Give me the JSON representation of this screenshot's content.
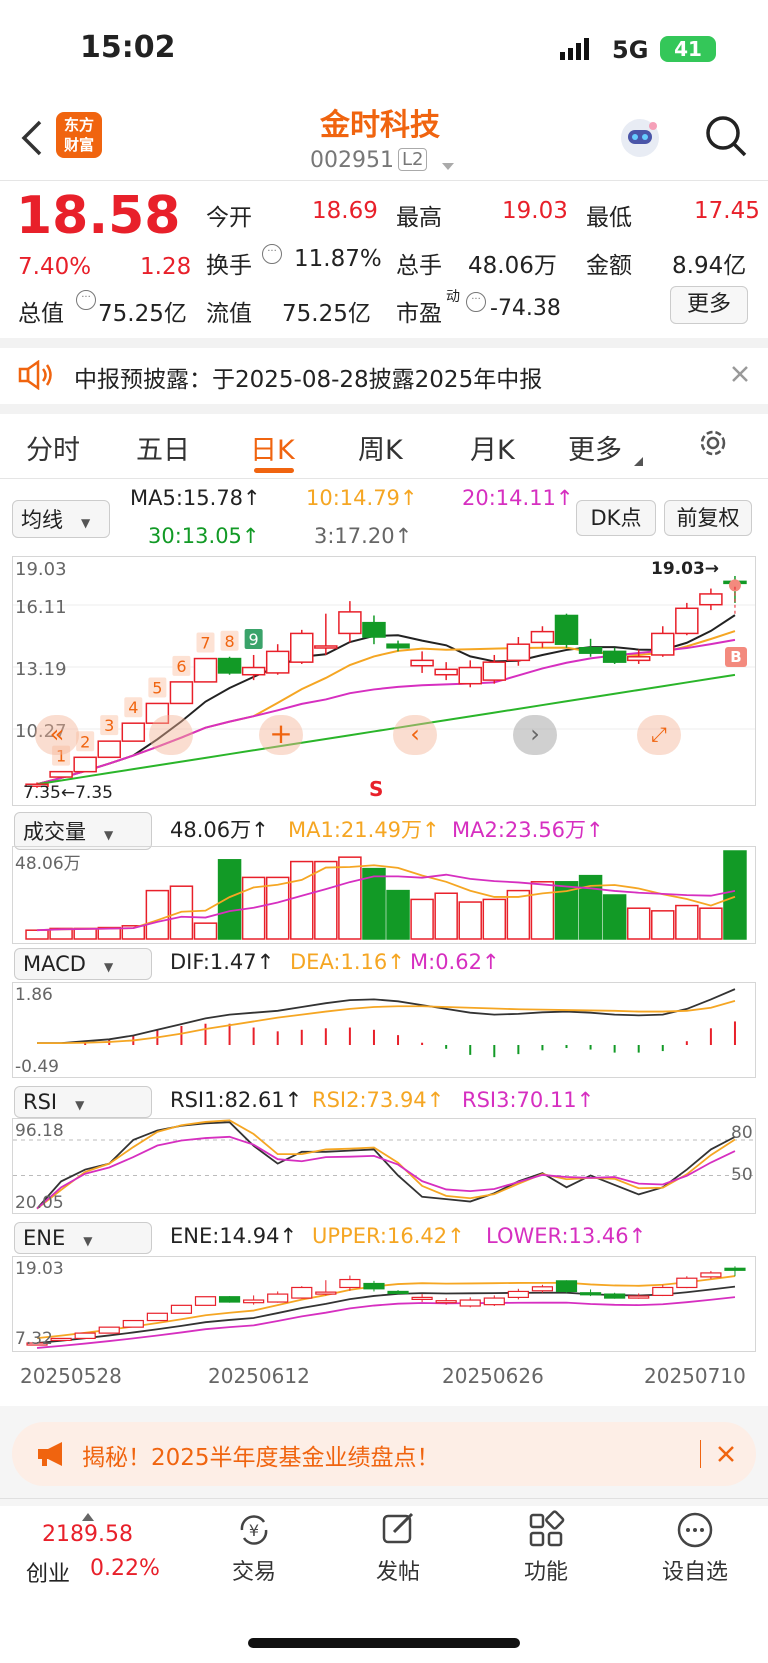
{
  "status": {
    "time": "15:02",
    "network": "5G",
    "battery": "41"
  },
  "header": {
    "logo": "东方\n财富",
    "title": "金时科技",
    "code": "002951",
    "level": "L2"
  },
  "quote": {
    "price": "18.58",
    "pct": "7.40%",
    "chg": "1.28",
    "items": [
      [
        "今开",
        "18.69"
      ],
      [
        "最高",
        "19.03"
      ],
      [
        "最低",
        "17.45"
      ],
      [
        "换手",
        "11.87%"
      ],
      [
        "总手",
        "48.06万"
      ],
      [
        "金额",
        "8.94亿"
      ],
      [
        "总值",
        "75.25亿"
      ],
      [
        "流值",
        "75.25亿"
      ],
      [
        "市盈",
        "-74.38"
      ]
    ],
    "pe_sup": "动",
    "more": "更多"
  },
  "notice": "中报预披露：于2025-08-28披露2025年中报",
  "tabs": [
    "分时",
    "五日",
    "日K",
    "周K",
    "月K",
    "更多"
  ],
  "ma_bar": {
    "selector": "均线",
    "ma5": "MA5:15.78",
    "ma10": "10:14.79",
    "ma20": "20:14.11",
    "ma30": "30:13.05",
    "ma3": "3:17.20",
    "dk": "DK点",
    "fq": "前复权"
  },
  "kline": {
    "axis": [
      "19.03",
      "16.11",
      "13.19",
      "10.27",
      "7.35"
    ],
    "high_label": "19.03",
    "low_label": "7.35",
    "counts": [
      "1",
      "2",
      "3",
      "4",
      "5",
      "6",
      "7",
      "8",
      "9"
    ],
    "signal": "S",
    "buy": "B"
  },
  "volume": {
    "selector": "成交量",
    "v": "48.06万",
    "ma1": "MA1:21.49万",
    "ma2": "MA2:23.56万",
    "axis_top": "48.06万"
  },
  "macd": {
    "selector": "MACD",
    "dif": "DIF:1.47",
    "dea": "DEA:1.16",
    "m": "M:0.62",
    "axis": [
      "1.86",
      "-0.49"
    ]
  },
  "rsi": {
    "selector": "RSI",
    "r1": "RSI1:82.61",
    "r2": "RSI2:73.94",
    "r3": "RSI3:70.11",
    "axis": [
      "96.18",
      "20.05"
    ],
    "lv": [
      "80",
      "50"
    ]
  },
  "ene": {
    "selector": "ENE",
    "ene": "ENE:14.94",
    "upper": "UPPER:16.42",
    "lower": "LOWER:13.46",
    "axis": [
      "19.03",
      "7.32"
    ]
  },
  "dates": [
    "20250528",
    "20250612",
    "20250626",
    "20250710"
  ],
  "banner": "揭秘！2025半年度基金业绩盘点！",
  "bottom": {
    "index_value": "2189.58",
    "index_name": "创业",
    "index_pct": "0.22%",
    "items": [
      "交易",
      "发帖",
      "功能",
      "设自选"
    ]
  },
  "colors": {
    "up": "#e8202a",
    "down": "#129a26",
    "ma5": "#222222",
    "ma10": "#f5a623",
    "ma20": "#d62fc0",
    "ma30": "#2ab52a",
    "accent": "#f0640f"
  }
}
